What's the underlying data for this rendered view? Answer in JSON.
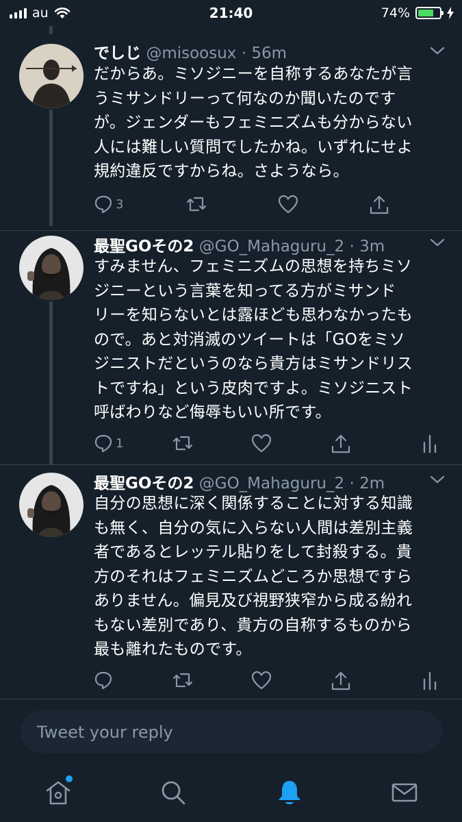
{
  "status_bar": {
    "carrier": "au",
    "time": "21:40",
    "battery_percent_label": "74%",
    "battery_level": 0.74
  },
  "tweets": [
    {
      "name": "でしじ",
      "handle": "@misoosux",
      "time": "56m",
      "lines": [
        "だからあ。ミソジニーを自称するあなたが言",
        "うミサンドリーって何なのか聞いたのです",
        "が。ジェンダーもフェミニズムも分からない",
        "人には難しい質問でしたかね。いずれにせよ",
        "規約違反ですからね。さようなら。"
      ],
      "reply_count": "3",
      "last_action": "share"
    },
    {
      "name": "最聖GOその2",
      "handle": "@GO_Mahaguru_2",
      "time": "3m",
      "lines": [
        "すみません、フェミニズムの思想を持ちミソ",
        "ジニーという言葉を知ってる方がミサンド",
        "リーを知らないとは露ほども思わなかったも",
        "ので。あと対消滅のツイートは「GOをミソ",
        "ジニストだというのなら貴方はミサンドリス",
        "トですね」という皮肉ですよ。ミソジニスト",
        "呼ばわりなど侮辱もいい所です。"
      ],
      "reply_count": "1",
      "last_action": "analytics"
    },
    {
      "name": "最聖GOその2",
      "handle": "@GO_Mahaguru_2",
      "time": "2m",
      "lines": [
        "自分の思想に深く関係することに対する知識",
        "も無く、自分の気に入らない人間は差別主義",
        "者であるとレッテル貼りをして封殺する。貴",
        "方のそれはフェミニズムどころか思想ですら",
        "ありません。偏見及び視野狭窄から成る紛れ",
        "もない差別であり、貴方の自称するものから",
        "最も離れたものです。"
      ],
      "reply_count": "",
      "last_action": "analytics"
    }
  ],
  "composer": {
    "placeholder": "Tweet your reply"
  },
  "tab_bar": {
    "items": [
      {
        "icon": "home-icon",
        "badge": true
      },
      {
        "icon": "search-icon",
        "badge": false
      },
      {
        "icon": "bell-icon",
        "active": true
      },
      {
        "icon": "mail-icon",
        "badge": false
      }
    ],
    "accent_color": "#1da1f2"
  },
  "colors": {
    "background": "#15202b",
    "secondary_text": "#8899a6",
    "divider": "#38444d",
    "battery": "#4cd964"
  }
}
